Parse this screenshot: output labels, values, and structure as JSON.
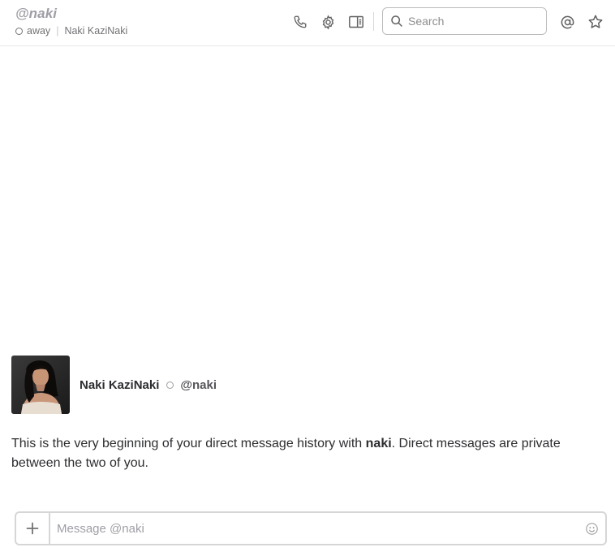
{
  "header": {
    "channel_name": "@naki",
    "presence": "away",
    "separator": "|",
    "full_name": "Naki KaziNaki",
    "search_placeholder": "Search",
    "icons": [
      "phone-icon",
      "gear-icon",
      "sidebar-toggle-icon",
      "search-icon",
      "mention-icon",
      "star-icon"
    ]
  },
  "intro": {
    "display_name": "Naki KaziNaki",
    "handle": "@naki",
    "text_before": "This is the very beginning of your direct message history with ",
    "username_bold": "naki",
    "text_after": ". Direct messages are private between the two of you."
  },
  "composer": {
    "placeholder": "Message @naki",
    "icons": [
      "plus-icon",
      "emoji-icon"
    ]
  },
  "colors": {
    "muted_text": "#717274",
    "channel_name": "#9e9ea6",
    "border": "#d6d6d6",
    "text": "#2c2d30"
  }
}
